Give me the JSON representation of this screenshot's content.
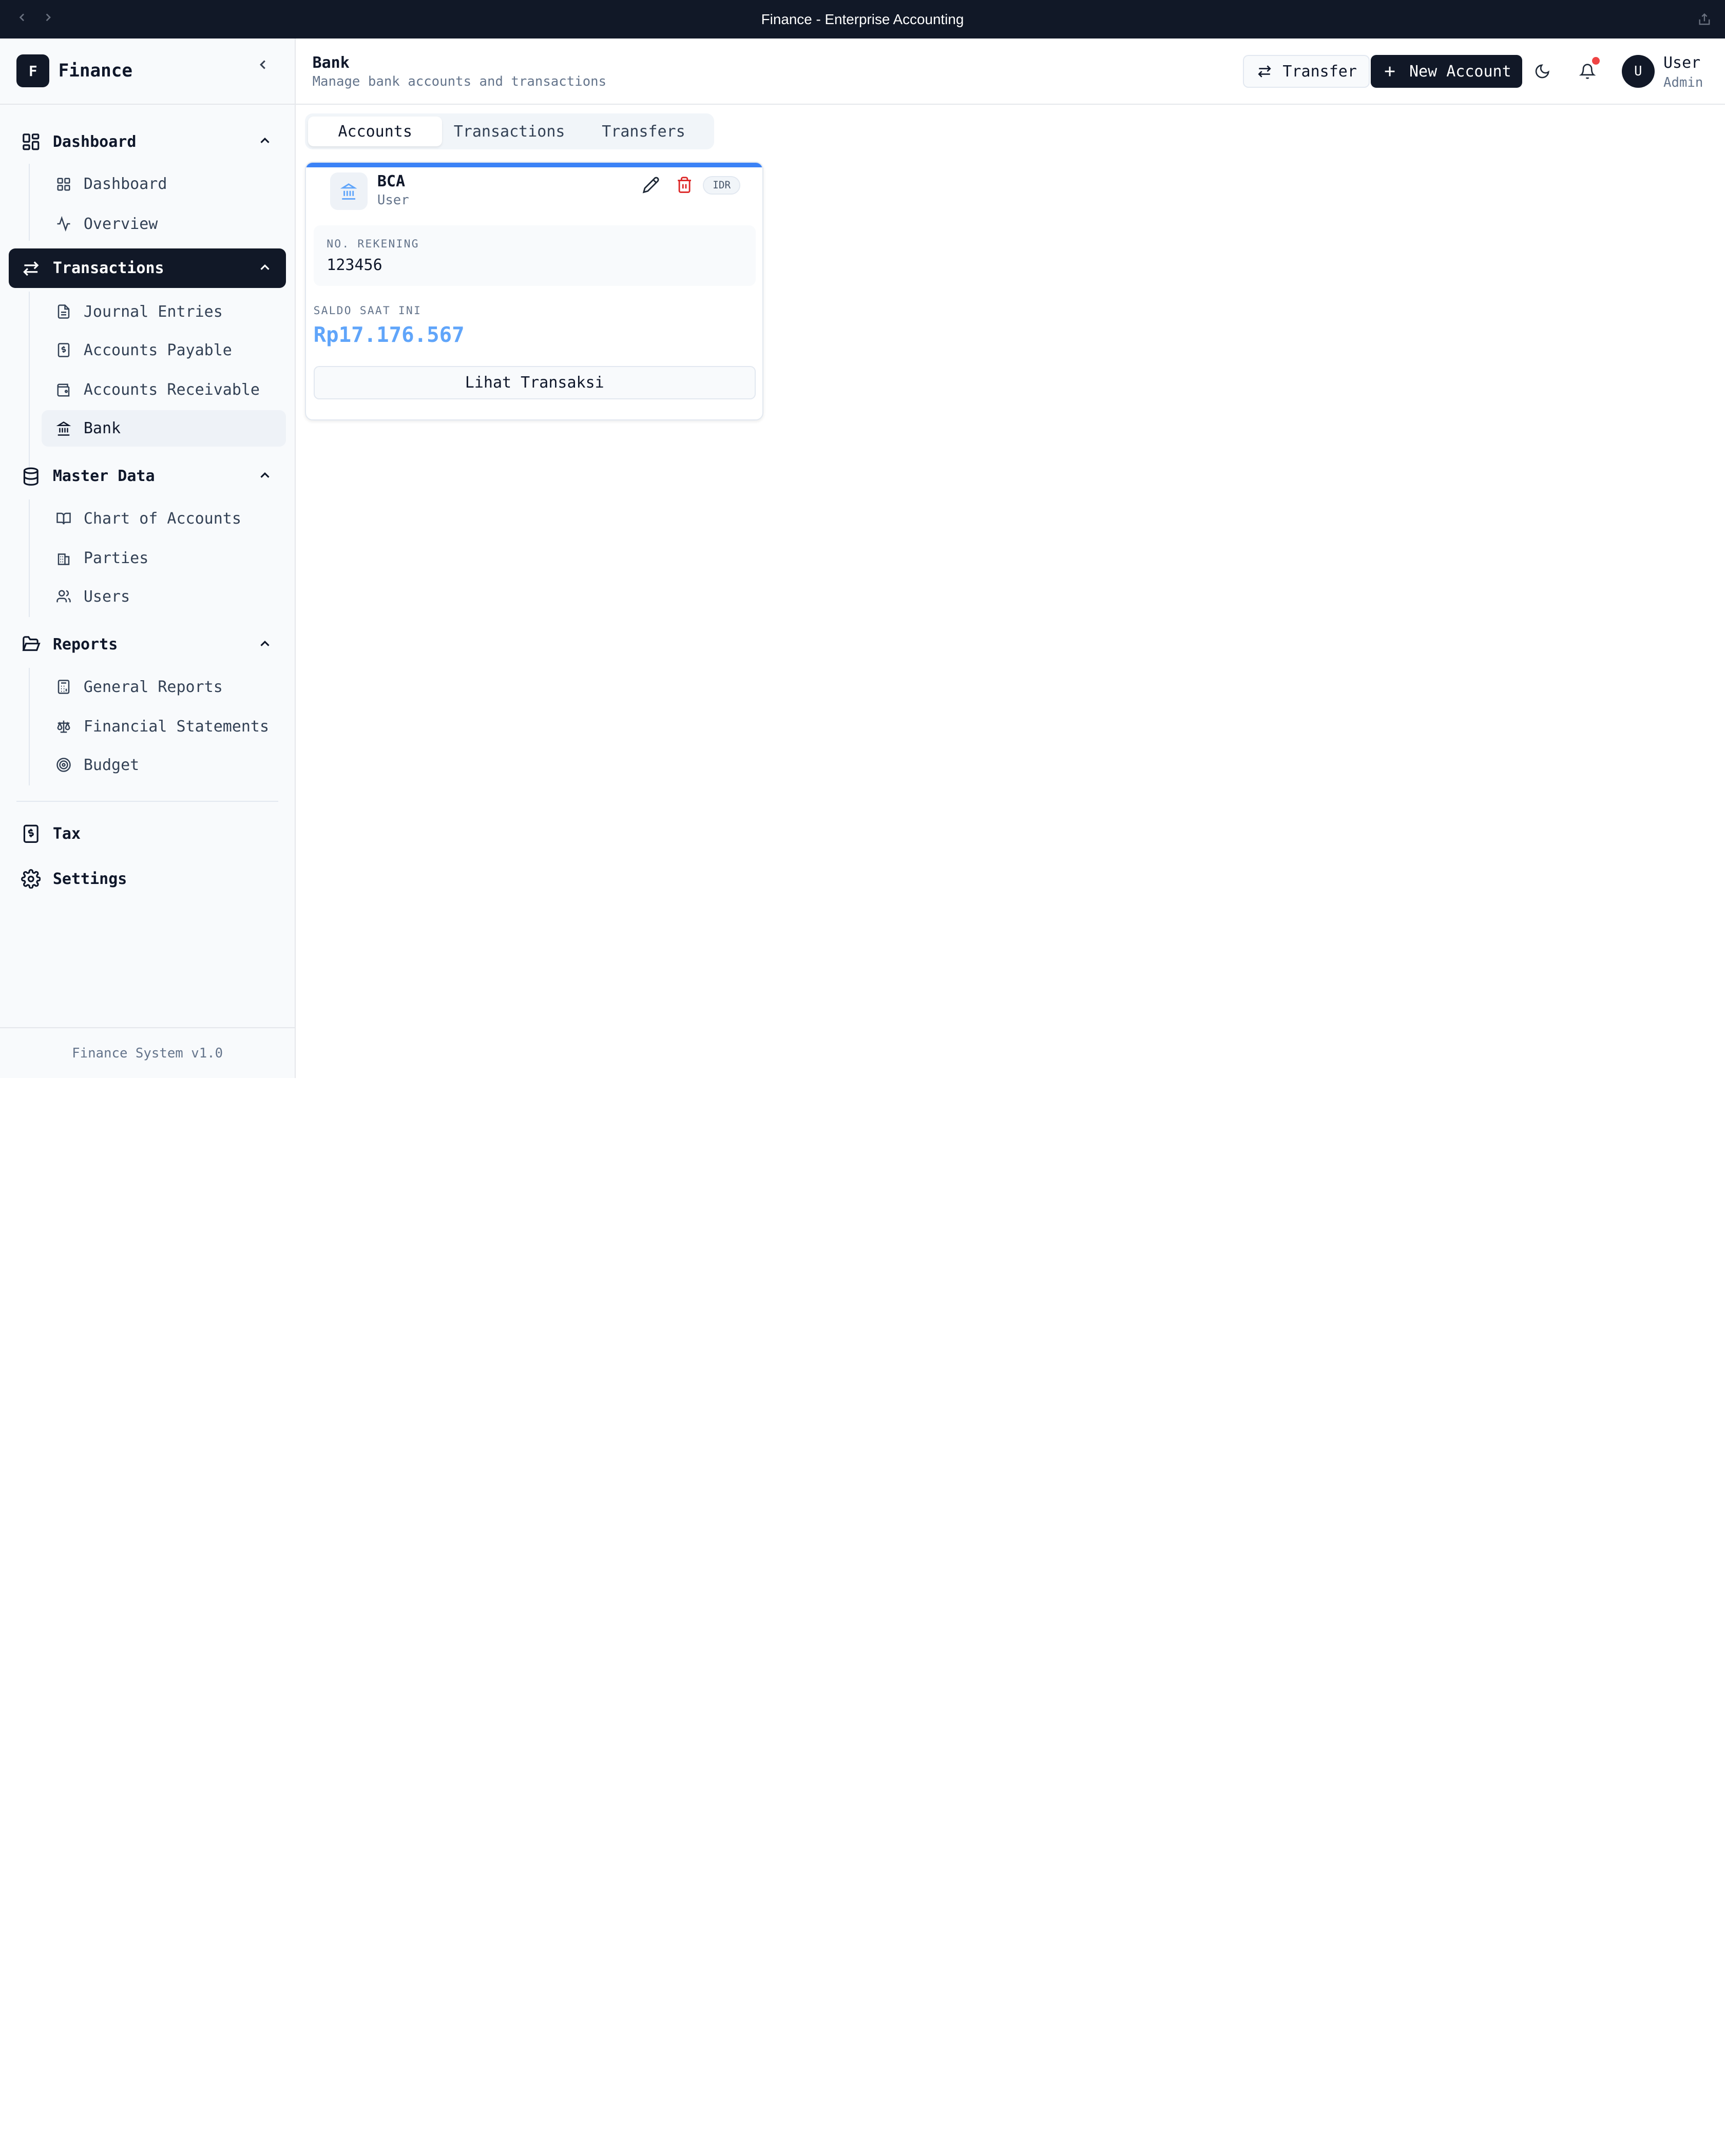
{
  "window": {
    "title": "Finance - Enterprise Accounting"
  },
  "brand": {
    "logo_letter": "F",
    "name": "Finance"
  },
  "sidebar": {
    "groups": [
      {
        "label": "Dashboard",
        "icon": "layout-grid-icon",
        "items": [
          {
            "label": "Dashboard",
            "icon": "layout-dashboard-icon"
          },
          {
            "label": "Overview",
            "icon": "activity-icon"
          }
        ]
      },
      {
        "label": "Transactions",
        "icon": "arrows-exchange-icon",
        "active": true,
        "items": [
          {
            "label": "Journal Entries",
            "icon": "file-text-icon"
          },
          {
            "label": "Accounts Payable",
            "icon": "receipt-dollar-icon"
          },
          {
            "label": "Accounts Receivable",
            "icon": "wallet-icon"
          },
          {
            "label": "Bank",
            "icon": "landmark-icon",
            "active": true
          }
        ]
      },
      {
        "label": "Master Data",
        "icon": "database-icon",
        "items": [
          {
            "label": "Chart of Accounts",
            "icon": "book-open-icon"
          },
          {
            "label": "Parties",
            "icon": "building-icon"
          },
          {
            "label": "Users",
            "icon": "users-icon"
          }
        ]
      },
      {
        "label": "Reports",
        "icon": "folder-open-icon",
        "items": [
          {
            "label": "General Reports",
            "icon": "calculator-icon"
          },
          {
            "label": "Financial Statements",
            "icon": "scale-icon"
          },
          {
            "label": "Budget",
            "icon": "target-icon"
          }
        ]
      }
    ],
    "standalone": [
      {
        "label": "Tax",
        "icon": "receipt-icon"
      },
      {
        "label": "Settings",
        "icon": "gear-icon"
      }
    ],
    "footer": "Finance System v1.0"
  },
  "header": {
    "title": "Bank",
    "subtitle": "Manage bank accounts and transactions",
    "transfer_label": "Transfer",
    "new_account_label": "New Account",
    "user": {
      "initial": "U",
      "name": "User",
      "role": "Admin"
    }
  },
  "tabs": [
    {
      "label": "Accounts",
      "active": true
    },
    {
      "label": "Transactions"
    },
    {
      "label": "Transfers"
    }
  ],
  "account_card": {
    "bank_name": "BCA",
    "owner": "User",
    "currency": "IDR",
    "account_number_label": "NO. REKENING",
    "account_number": "123456",
    "balance_label": "SALDO SAAT INI",
    "balance": "Rp17.176.567",
    "view_button": "Lihat Transaksi"
  },
  "colors": {
    "sidebar_active_bg": "#111827",
    "accent_blue": "#3b82f6",
    "balance_blue": "#60a5fa",
    "danger_red": "#dc2626",
    "notification_dot": "#ef4444"
  }
}
